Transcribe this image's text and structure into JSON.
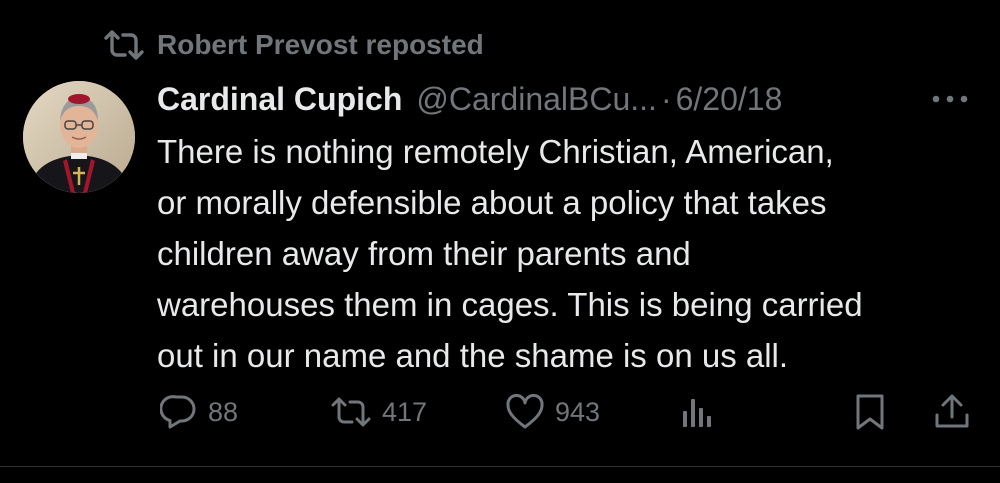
{
  "repost": {
    "icon": "repost-icon",
    "label": "Robert Prevost reposted"
  },
  "author": {
    "display_name": "Cardinal Cupich",
    "handle": "@CardinalBCu...",
    "separator": "·",
    "date": "6/20/18",
    "avatar": "avatar-photo"
  },
  "body": {
    "lines": [
      "There is nothing remotely Christian, American,",
      "or morally defensible about a policy that takes",
      "children away from their parents and",
      "warehouses them in cages. This is being carried",
      "out in our name and the shame is on us all."
    ]
  },
  "actions": {
    "reply_count": "88",
    "repost_count": "417",
    "like_count": "943",
    "icons": [
      "reply-icon",
      "repost-icon",
      "like-icon",
      "views-icon",
      "bookmark-icon",
      "share-icon",
      "more-icon"
    ]
  },
  "colors": {
    "background": "#000000",
    "primary_text": "#e7e9ea",
    "secondary_text": "#71767b",
    "divider": "#2f3336"
  }
}
